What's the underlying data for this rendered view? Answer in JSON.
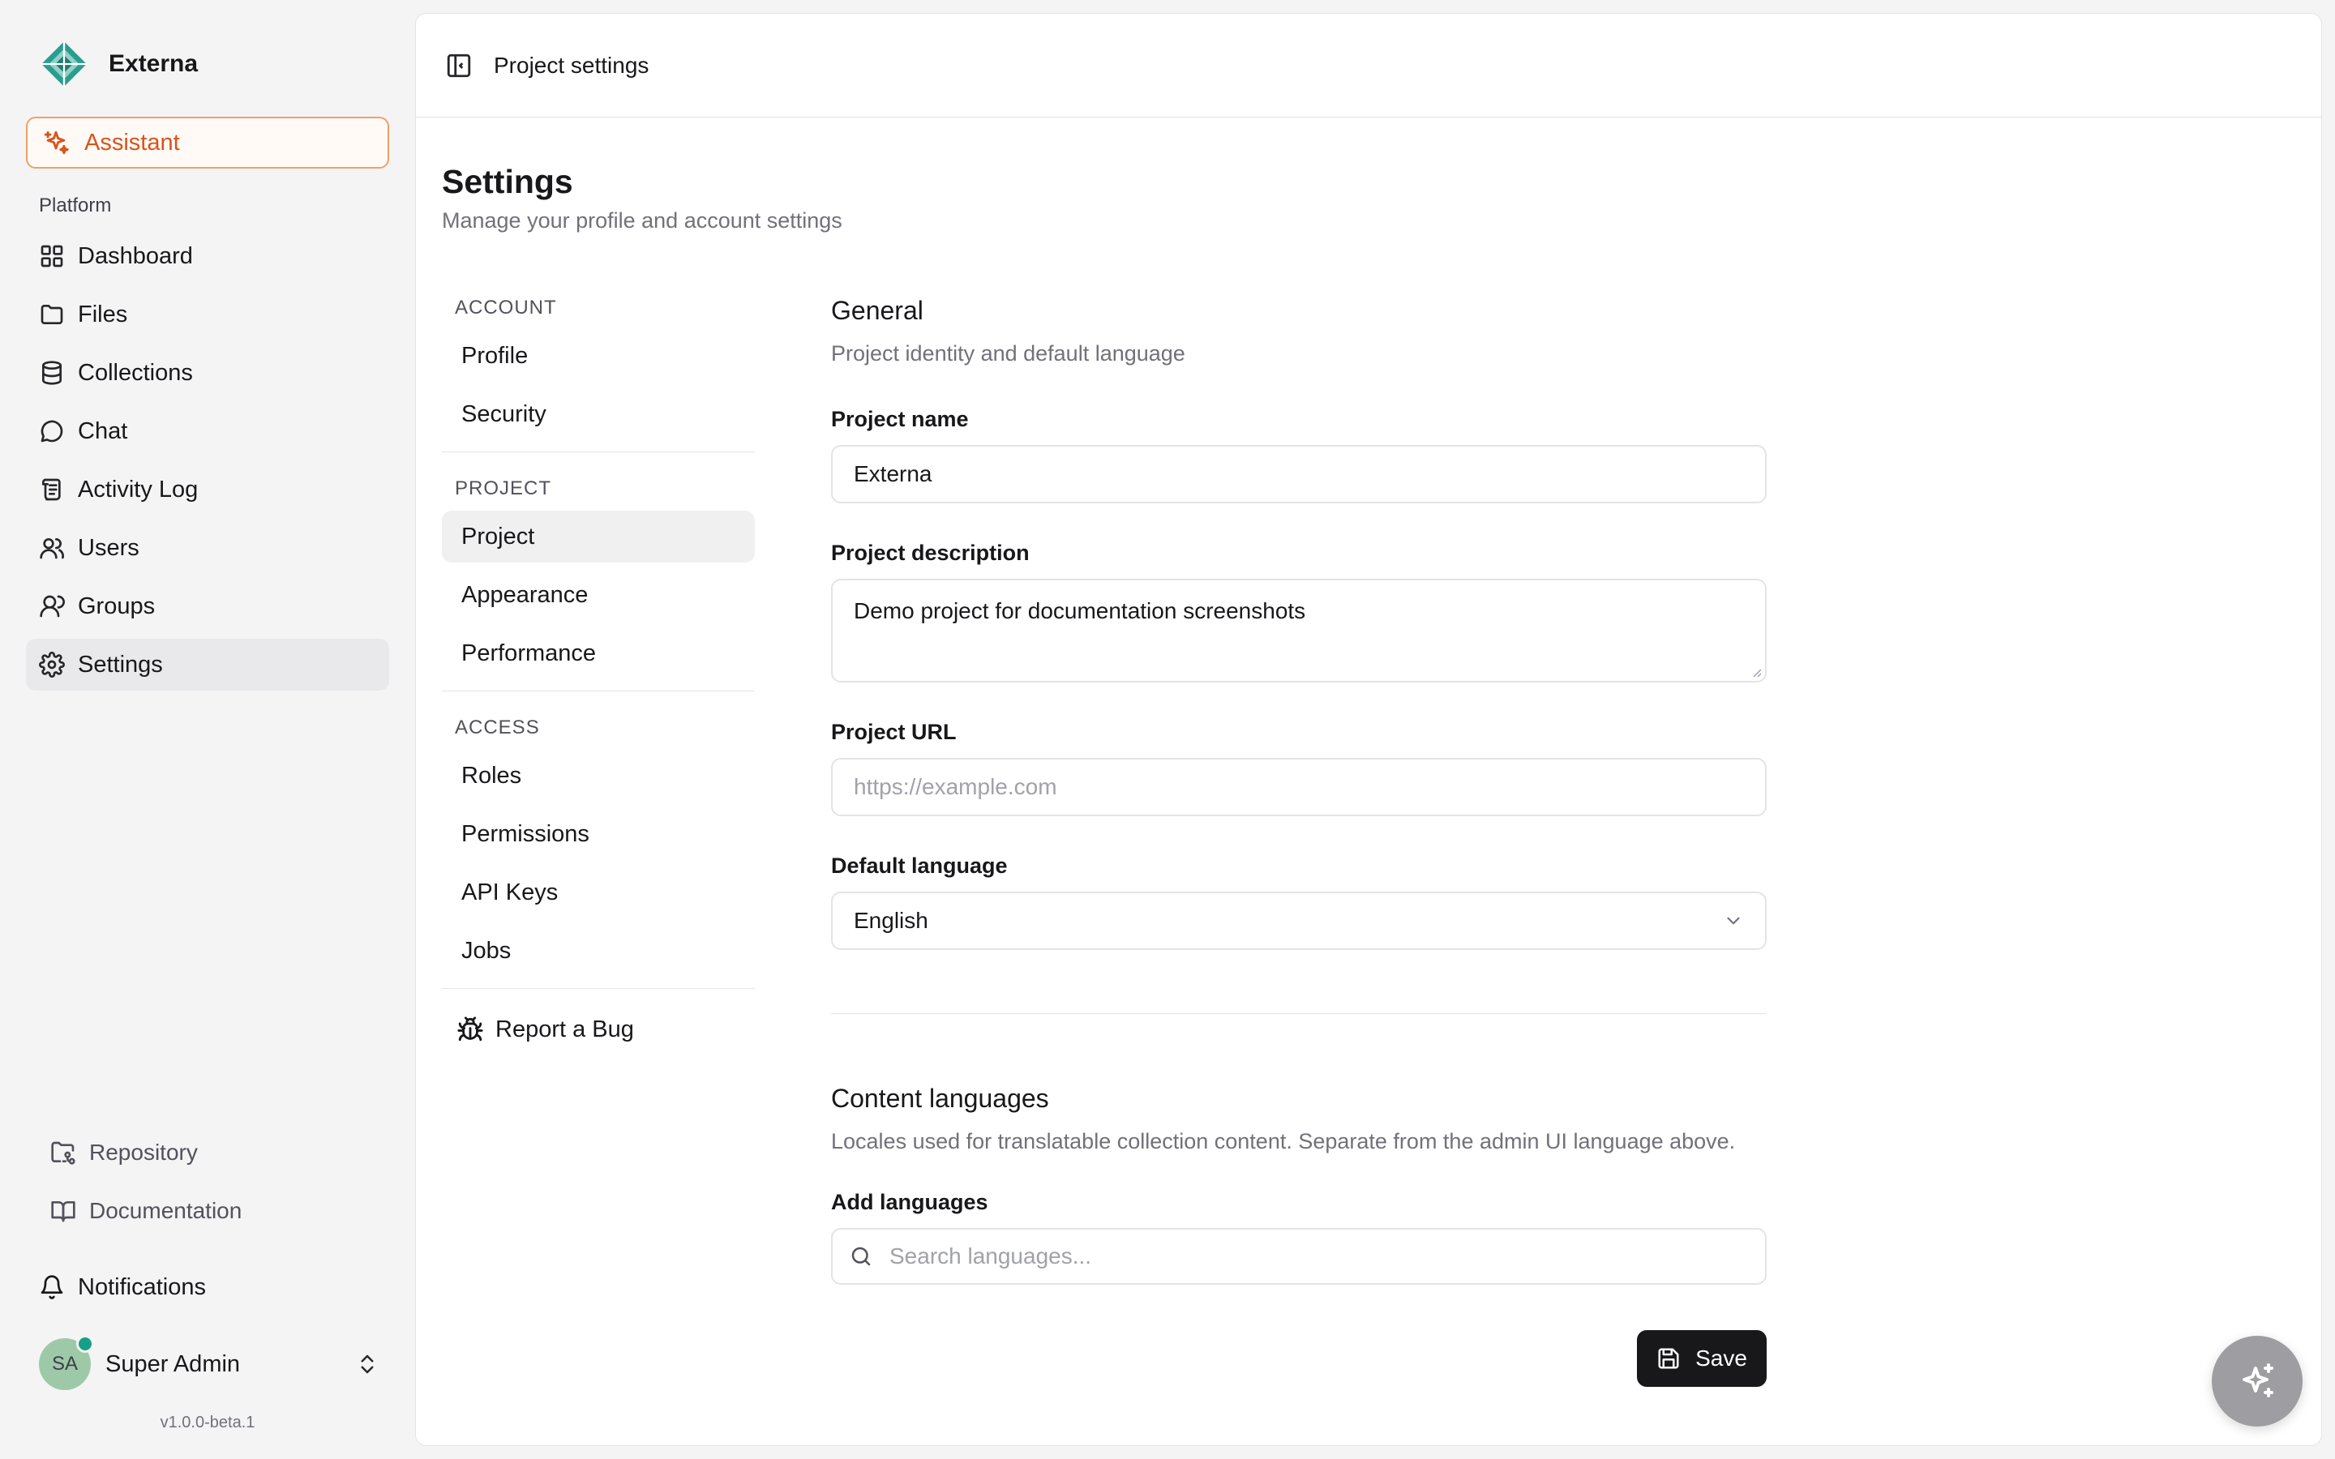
{
  "brand": {
    "name": "Externa",
    "logo_icon": "externa-logo-icon",
    "logo_color": "#2a9d8f"
  },
  "assistant": {
    "label": "Assistant",
    "icon": "sparkles-icon",
    "color": "#d9541b"
  },
  "sidebar": {
    "section_label": "Platform",
    "items": [
      {
        "label": "Dashboard",
        "icon": "dashboard-grid-icon"
      },
      {
        "label": "Files",
        "icon": "folder-icon"
      },
      {
        "label": "Collections",
        "icon": "database-icon"
      },
      {
        "label": "Chat",
        "icon": "chat-bubble-icon"
      },
      {
        "label": "Activity Log",
        "icon": "scroll-log-icon"
      },
      {
        "label": "Users",
        "icon": "users-icon"
      },
      {
        "label": "Groups",
        "icon": "user-group-icon"
      },
      {
        "label": "Settings",
        "icon": "gear-icon"
      }
    ],
    "active_item": "Settings",
    "bottom_links": [
      {
        "label": "Repository",
        "icon": "folder-git-icon"
      },
      {
        "label": "Documentation",
        "icon": "book-open-icon"
      }
    ],
    "notifications": {
      "label": "Notifications",
      "icon": "bell-icon"
    },
    "user": {
      "initials": "SA",
      "name": "Super Admin",
      "status_color": "#16a085"
    },
    "version": "v1.0.0-beta.1"
  },
  "topbar": {
    "breadcrumb": "Project settings",
    "toggle_icon": "panel-left-icon"
  },
  "page": {
    "title": "Settings",
    "subtitle": "Manage your profile and account settings"
  },
  "subnav": {
    "groups": [
      {
        "label": "ACCOUNT",
        "items": [
          "Profile",
          "Security"
        ]
      },
      {
        "label": "PROJECT",
        "items": [
          "Project",
          "Appearance",
          "Performance"
        ]
      },
      {
        "label": "ACCESS",
        "items": [
          "Roles",
          "Permissions",
          "API Keys",
          "Jobs"
        ]
      }
    ],
    "active_item": "Project",
    "report_bug": {
      "label": "Report a Bug",
      "icon": "bug-icon"
    }
  },
  "general": {
    "title": "General",
    "description": "Project identity and default language",
    "project_name": {
      "label": "Project name",
      "value": "Externa"
    },
    "project_description": {
      "label": "Project description",
      "value": "Demo project for documentation screenshots"
    },
    "project_url": {
      "label": "Project URL",
      "placeholder": "https://example.com",
      "value": ""
    },
    "default_language": {
      "label": "Default language",
      "value": "English"
    }
  },
  "content_languages": {
    "title": "Content languages",
    "description": "Locales used for translatable collection content. Separate from the admin UI language above.",
    "add_label": "Add languages",
    "search_placeholder": "Search languages..."
  },
  "save": {
    "label": "Save",
    "icon": "floppy-disk-icon"
  },
  "fab": {
    "icon": "sparkles-icon"
  }
}
